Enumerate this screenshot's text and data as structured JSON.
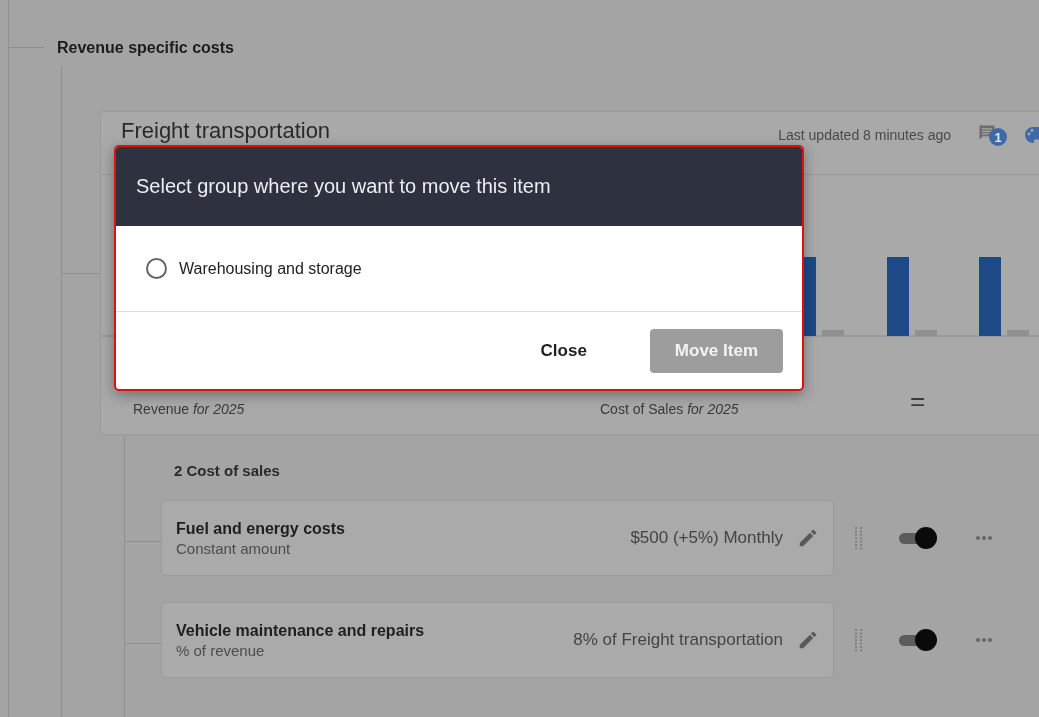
{
  "section": {
    "title": "Revenue specific costs"
  },
  "card": {
    "title": "Freight transportation",
    "updated": "Last updated 8 minutes ago",
    "comment_badge": "1",
    "labels": [
      "Revenue *for 2025*",
      "Cost of Sales *for 2025*"
    ],
    "operator": "="
  },
  "group": {
    "title": "2 Cost of sales",
    "items": [
      {
        "name": "Fuel and energy costs",
        "type": "Constant amount",
        "value": "$500 (+5%) Monthly",
        "on": true
      },
      {
        "name": "Vehicle maintenance and repairs",
        "type": "% of revenue",
        "value": "8% of Freight transportation",
        "on": true
      }
    ]
  },
  "dialog": {
    "title": "Select group where you want to move this item",
    "options": [
      {
        "label": "Warehousing and storage",
        "selected": false
      }
    ],
    "buttons": [
      {
        "label": "Close",
        "kind": "text"
      },
      {
        "label": "Move Item",
        "kind": "primary",
        "disabled": true
      }
    ]
  }
}
